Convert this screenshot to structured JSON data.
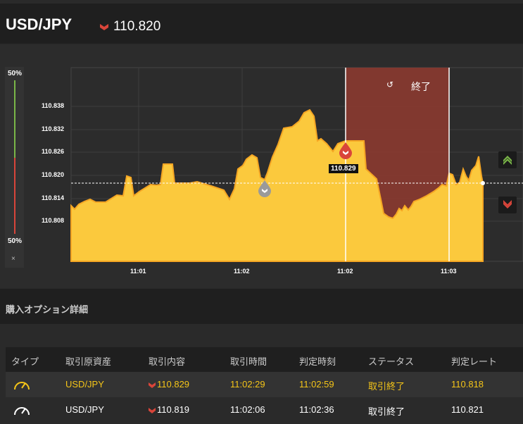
{
  "header": {
    "pair": "USD/JPY",
    "price": "110.820",
    "direction": "down"
  },
  "ratio": {
    "high_pct": "50%",
    "low_pct": "50%",
    "close": "×"
  },
  "chart_data": {
    "type": "area",
    "y_ticks": [
      "110.838",
      "110.832",
      "110.826",
      "110.820",
      "110.814",
      "110.808"
    ],
    "x_ticks": [
      "11:01",
      "11:02",
      "11:02",
      "11:03"
    ],
    "current_rate": 110.818,
    "entry_rate_label": "110.829",
    "end_label": "終了",
    "colors": {
      "area": "#fbc93d",
      "line": "#f5a623",
      "expired_zone": "#8b3a30"
    }
  },
  "buttons": {
    "high": "high-arrow",
    "low": "low-arrow"
  },
  "section": {
    "title": "購入オプション詳細"
  },
  "table": {
    "headers": [
      "タイプ",
      "取引原資産",
      "取引内容",
      "取引時間",
      "判定時刻",
      "ステータス",
      "判定レート"
    ],
    "rows": [
      {
        "asset": "USD/JPY",
        "content": "110.829",
        "time": "11:02:29",
        "judge_time": "11:02:59",
        "status": "取引終了",
        "rate": "110.818"
      },
      {
        "asset": "USD/JPY",
        "content": "110.819",
        "time": "11:02:06",
        "judge_time": "11:02:36",
        "status": "取引終了",
        "rate": "110.821"
      }
    ]
  }
}
